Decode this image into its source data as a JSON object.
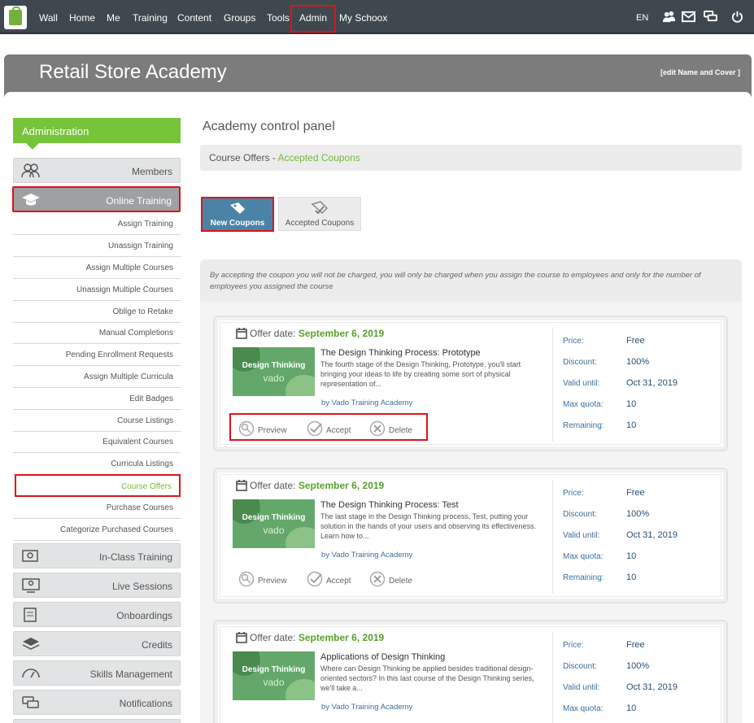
{
  "nav": {
    "items": [
      "Wall",
      "Home",
      "Me",
      "Training",
      "Content",
      "Groups",
      "Tools",
      "Admin",
      "My Schoox"
    ],
    "lang": "EN"
  },
  "header": {
    "title": "Retail Store Academy",
    "edit_link": "[edit Name and Cover ]"
  },
  "sidebar": {
    "heading": "Administration",
    "members": "Members",
    "online_training": "Online Training",
    "sub_items": [
      "Assign Training",
      "Unassign Training",
      "Assign Multiple Courses",
      "Unassign Multiple Courses",
      "Oblige to Retake",
      "Manual Completions",
      "Pending Enrollment Requests",
      "Assign Multiple Curricula",
      "Edit Badges",
      "Course Listings",
      "Equivalent Courses",
      "Curricula Listings",
      "Course Offers",
      "Purchase Courses",
      "Categorize Purchased Courses"
    ],
    "sections": [
      "In-Class Training",
      "Live Sessions",
      "Onboardings",
      "Credits",
      "Skills Management",
      "Notifications"
    ]
  },
  "main": {
    "panel_title": "Academy control panel",
    "crumb_main": "Course Offers",
    "crumb_sep": " - ",
    "crumb_link": "Accepted Coupons",
    "tabs": {
      "new": "New Coupons",
      "accepted": "Accepted Coupons"
    },
    "notice": "By accepting the coupon you will not be charged, you will only be charged when you assign the course to employees and only for the number of employees you assigned the course"
  },
  "offer_labels": {
    "offer_date": "Offer date:",
    "price": "Price:",
    "discount": "Discount:",
    "valid_until": "Valid until:",
    "max_quota": "Max quota:",
    "remaining": "Remaining:",
    "preview": "Preview",
    "accept": "Accept",
    "delete": "Delete",
    "thumb_line1": "Design Thinking",
    "thumb_line2": "vado"
  },
  "offers": [
    {
      "date": "September 6, 2019",
      "title": "The Design Thinking Process: Prototype",
      "desc": "The fourth stage of the Design Thinking, Prototype, you'll start bringing your ideas to life by creating some sort of physical representation of...",
      "by": "by Vado Training Academy",
      "price": "Free",
      "discount": "100%",
      "valid": "Oct 31, 2019",
      "quota": "10",
      "remaining": "10"
    },
    {
      "date": "September 6, 2019",
      "title": "The Design Thinking Process: Test",
      "desc": "The last stage in the Design Thinking process, Test, putting your solution in the hands of your users and observing its effectiveness. Learn how to...",
      "by": "by Vado Training Academy",
      "price": "Free",
      "discount": "100%",
      "valid": "Oct 31, 2019",
      "quota": "10",
      "remaining": "10"
    },
    {
      "date": "September 6, 2019",
      "title": "Applications of Design Thinking",
      "desc": "Where can Design Thinking be applied besides traditional design-oriented sectors? In this last course of the Design Thinking series, we'll take a...",
      "by": "by Vado Training Academy",
      "price": "Free",
      "discount": "100%",
      "valid": "Oct 31, 2019",
      "quota": "10"
    }
  ]
}
